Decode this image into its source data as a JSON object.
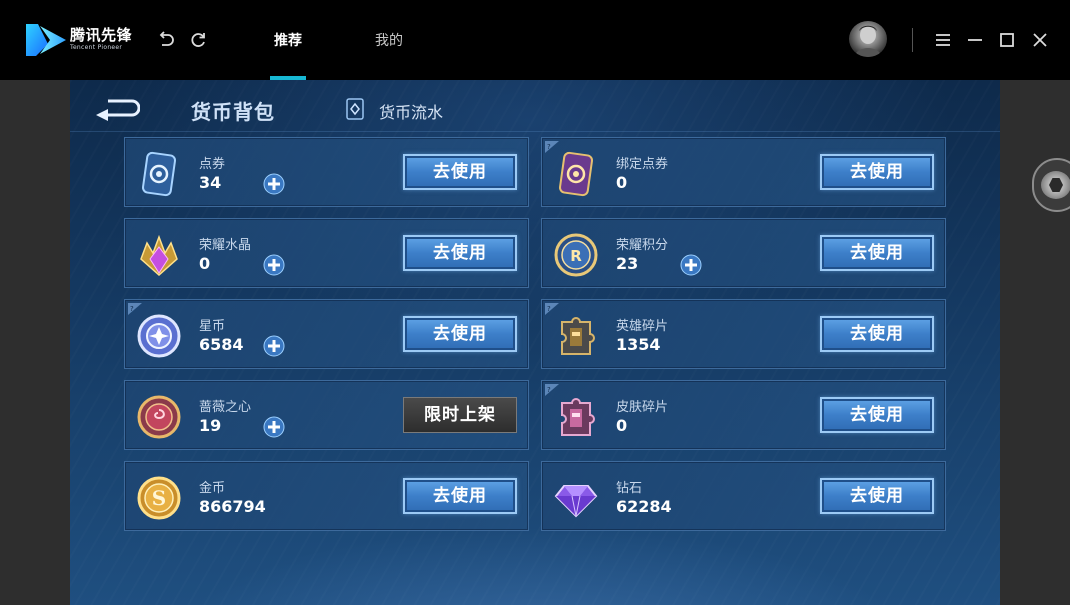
{
  "app": {
    "brand_cn": "腾讯先锋",
    "brand_en": "Tencent Pioneer",
    "accent_color": "#17b8d4"
  },
  "titlebar": {
    "icons": [
      "undo-icon",
      "refresh-icon",
      "menu-icon",
      "minimize-icon",
      "maximize-icon",
      "close-icon"
    ],
    "tabs": [
      {
        "label": "推荐",
        "active": true
      },
      {
        "label": "我的",
        "active": false
      }
    ]
  },
  "game": {
    "title": "货币背包",
    "flow_link": "货币流水",
    "use_label": "去使用",
    "limited_label": "限时上架",
    "currencies": [
      {
        "name": "点券",
        "amount": "34",
        "has_plus": true,
        "action": "use",
        "icon": "coupon-icon",
        "info": false
      },
      {
        "name": "绑定点券",
        "amount": "0",
        "has_plus": false,
        "action": "use",
        "icon": "bound-coupon-icon",
        "info": true
      },
      {
        "name": "荣耀水晶",
        "amount": "0",
        "has_plus": true,
        "action": "use",
        "icon": "crystal-icon",
        "info": false
      },
      {
        "name": "荣耀积分",
        "amount": "23",
        "has_plus": true,
        "action": "use",
        "icon": "honor-points-icon",
        "info": false
      },
      {
        "name": "星币",
        "amount": "6584",
        "has_plus": true,
        "action": "use",
        "icon": "star-coin-icon",
        "info": true
      },
      {
        "name": "英雄碎片",
        "amount": "1354",
        "has_plus": false,
        "action": "use",
        "icon": "hero-shard-icon",
        "info": true
      },
      {
        "name": "蔷薇之心",
        "amount": "19",
        "has_plus": true,
        "action": "limited",
        "icon": "rose-heart-icon",
        "info": false
      },
      {
        "name": "皮肤碎片",
        "amount": "0",
        "has_plus": false,
        "action": "use",
        "icon": "skin-shard-icon",
        "info": true
      },
      {
        "name": "金币",
        "amount": "866794",
        "has_plus": false,
        "action": "use",
        "icon": "gold-coin-icon",
        "info": false
      },
      {
        "name": "钻石",
        "amount": "62284",
        "has_plus": false,
        "action": "use",
        "icon": "diamond-icon",
        "info": false
      }
    ]
  }
}
